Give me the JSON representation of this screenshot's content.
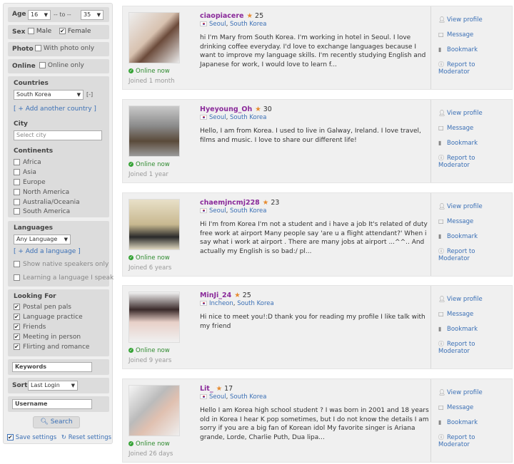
{
  "filters": {
    "age_label": "Age",
    "age_from": "16",
    "age_to_label": "-- to --",
    "age_to": "35",
    "sex_label": "Sex",
    "sex_male": "Male",
    "sex_female": "Female",
    "photo_label": "Photo",
    "photo_option": "With photo only",
    "online_label": "Online",
    "online_option": "Online only",
    "countries_label": "Countries",
    "country_selected": "South Korea",
    "country_remove": "[-]",
    "add_country": "[ + Add another country ]",
    "city_label": "City",
    "city_placeholder": "Select city",
    "continents_label": "Continents",
    "continents": [
      "Africa",
      "Asia",
      "Europe",
      "North America",
      "Australia/Oceania",
      "South America"
    ],
    "languages_label": "Languages",
    "language_selected": "Any Language",
    "add_language": "[ + Add a language ]",
    "native_only": "Show native speakers only",
    "learning_only": "Learning a language I speak",
    "looking_for_label": "Looking For",
    "looking_for": [
      "Postal pen pals",
      "Language practice",
      "Friends",
      "Meeting in person",
      "Flirting and romance"
    ],
    "keywords_placeholder": "Keywords",
    "sort_label": "Sort",
    "sort_selected": "Last Login",
    "username_placeholder": "Username",
    "search_button": "Search",
    "save_settings": "Save settings",
    "reset_settings": "Reset settings"
  },
  "actions": {
    "view": "View profile",
    "message": "Message",
    "bookmark": "Bookmark",
    "report": "Report to",
    "report2": "Moderator"
  },
  "online_text": "Online now",
  "profiles": [
    {
      "name": "ciaopiacere",
      "age": "25",
      "city": "Seoul",
      "country": "South Korea",
      "bio": "hi I'm Mary from South Korea. I'm working in hotel in Seoul. I love drinking coffee everyday. I'd love to exchange languages because I want to improve my language skills. I'm recently studying English and Japanese for work, I would love to learn f...",
      "joined": "Joined 1 month"
    },
    {
      "name": "Hyeyoung_Oh",
      "age": "30",
      "city": "Seoul",
      "country": "South Korea",
      "bio": "Hello, I am from Korea. I used to live in Galway, Ireland. I love travel, films and music. I love to share our different life!",
      "joined": "Joined 1 year"
    },
    {
      "name": "chaemjncmj228",
      "age": "23",
      "city": "Seoul",
      "country": "South Korea",
      "bio": "Hi I'm from Korea I'm not a student and i have a job It's related of duty free work at airport Many people say 'are u a flight attendant?' When i say what i work at airport . There are many jobs at airport ...^^.. And actually my English is so bad:/ pl...",
      "joined": "Joined 6 years"
    },
    {
      "name": "MinJi_24",
      "age": "25",
      "city": "Incheon",
      "country": "South Korea",
      "bio": "Hi nice to meet you!:D thank you for reading my profile I like talk with my friend",
      "joined": "Joined 9 years"
    },
    {
      "name": "Lit_",
      "age": "17",
      "city": "Seoul",
      "country": "South Korea",
      "bio": "Hello I am Korea high school student ? I was born in 2001 and 18 years old in Korea I hear K pop sometimes, but I do not know the details I am sorry if you are a big fan of Korean idol My favorite singer is Ariana grande, Lorde, Charlie Puth, Dua lipa...",
      "joined": "Joined 26 days"
    }
  ]
}
